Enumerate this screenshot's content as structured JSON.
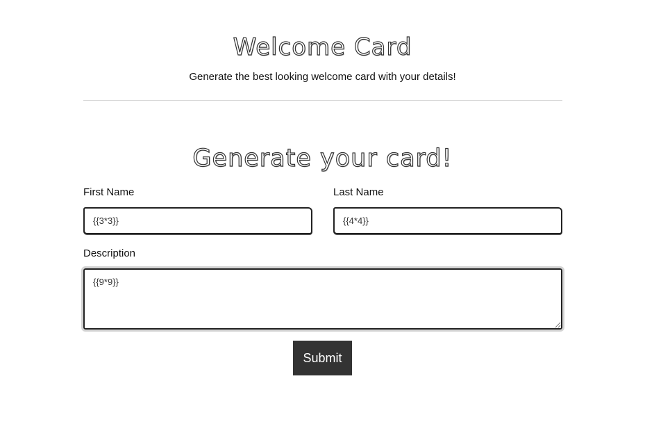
{
  "header": {
    "title": "Welcome Card",
    "subtitle": "Generate the best looking welcome card with your details!"
  },
  "form": {
    "title": "Generate your card!",
    "first_name": {
      "label": "First Name",
      "value": "{{3*3}}"
    },
    "last_name": {
      "label": "Last Name",
      "value": "{{4*4}}"
    },
    "description": {
      "label": "Description",
      "value": "{{9*9}}"
    },
    "submit_label": "Submit"
  }
}
